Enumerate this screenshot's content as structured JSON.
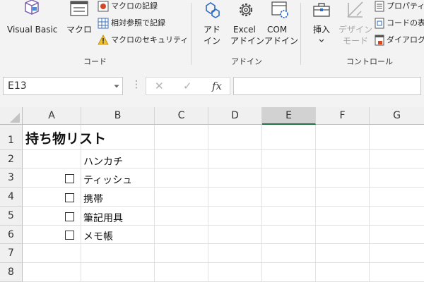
{
  "ribbon": {
    "code_group": {
      "visual_basic_label": "Visual Basic",
      "macro_label": "マクロ",
      "record_macro_label": "マクロの記録",
      "relative_ref_label": "相対参照で記録",
      "macro_security_label": "マクロのセキュリティ",
      "group_label": "コード"
    },
    "addins_group": {
      "addins_line1": "アド",
      "addins_line2": "イン",
      "excel_addins_line1": "Excel",
      "excel_addins_line2": "アドイン",
      "com_addins_line1": "COM",
      "com_addins_line2": "アドイン",
      "group_label": "アドイン"
    },
    "controls_group": {
      "insert_label": "挿入",
      "design_mode_line1": "デザイン",
      "design_mode_line2": "モード",
      "properties_label": "プロパティ",
      "view_code_label": "コードの表",
      "run_dialog_label": "ダイアログ",
      "group_label": "コントロール"
    }
  },
  "formula_bar": {
    "name_box": "E13",
    "cancel_glyph": "✕",
    "enter_glyph": "✓",
    "fx_label": "fx",
    "formula_value": ""
  },
  "sheet": {
    "columns": [
      "A",
      "B",
      "C",
      "D",
      "E",
      "F",
      "G"
    ],
    "selected_column": "E",
    "rows": [
      "1",
      "2",
      "3",
      "4",
      "5",
      "6",
      "7",
      "8"
    ],
    "title": "持ち物リスト",
    "items": [
      {
        "label": "ハンカチ",
        "checkbox": false
      },
      {
        "label": "ティッシュ",
        "checkbox": true
      },
      {
        "label": "携帯",
        "checkbox": true
      },
      {
        "label": "筆記用具",
        "checkbox": true
      },
      {
        "label": "メモ帳",
        "checkbox": true
      }
    ]
  },
  "colors": {
    "ribbon_bg": "#f3f3f3",
    "selected_column_accent": "#217346",
    "grid_line": "#e1e1e1",
    "header_bg": "#f0f0f0"
  }
}
